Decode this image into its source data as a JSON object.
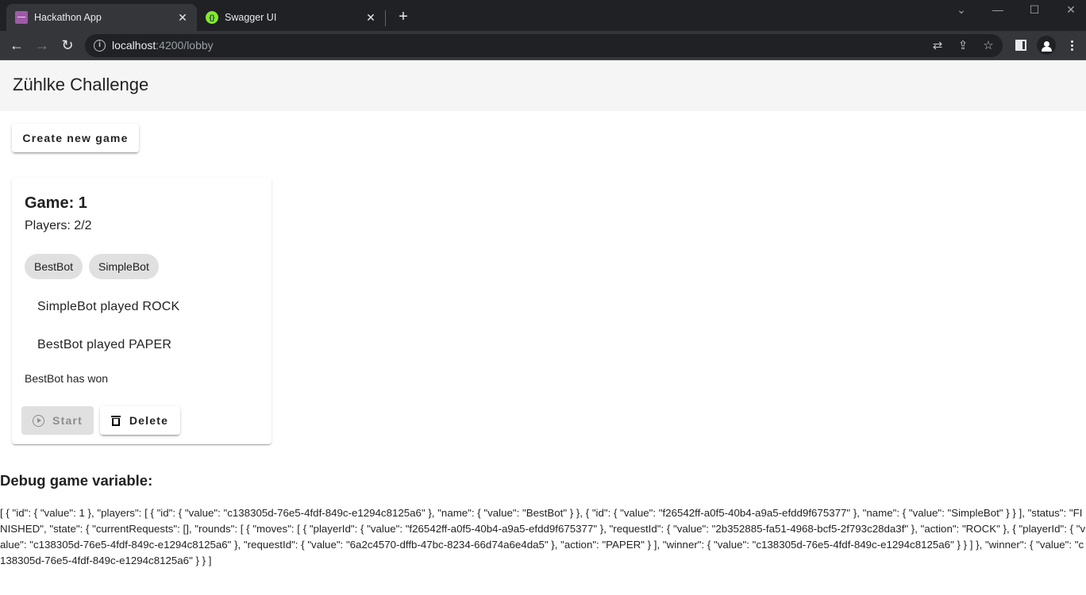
{
  "browser": {
    "tabs": [
      {
        "title": "Hackathon App",
        "favicon": "zuhlke-logo-icon",
        "active": true
      },
      {
        "title": "Swagger UI",
        "favicon": "swagger-icon",
        "active": false
      }
    ],
    "new_tab": "+",
    "close_glyph": "✕",
    "url_host": "localhost",
    "url_path": ":4200/lobby",
    "window_controls": {
      "dropdown": "⌄",
      "minimize": "—",
      "maximize": "☐",
      "close": "✕"
    },
    "nav": {
      "back": "←",
      "forward": "→",
      "reload": "↻"
    },
    "omnibox_icons": {
      "translate": "⇄",
      "share": "⇪",
      "bookmark": "☆"
    }
  },
  "app": {
    "title": "Zühlke Challenge",
    "create_button": "Create new game",
    "game": {
      "title": "Game: 1",
      "players": "Players: 2/2",
      "player_chips": [
        "BestBot",
        "SimpleBot"
      ],
      "moves": [
        "SimpleBot played ROCK",
        "BestBot played PAPER"
      ],
      "result": "BestBot has won",
      "start_button": "Start",
      "delete_button": "Delete"
    },
    "debug": {
      "title": "Debug game variable:",
      "text": "[ { \"id\": { \"value\": 1 }, \"players\": [ { \"id\": { \"value\": \"c138305d-76e5-4fdf-849c-e1294c8125a6\" }, \"name\": { \"value\": \"BestBot\" } }, { \"id\": { \"value\": \"f26542ff-a0f5-40b4-a9a5-efdd9f675377\" }, \"name\": { \"value\": \"SimpleBot\" } } ], \"status\": \"FINISHED\", \"state\": { \"currentRequests\": [], \"rounds\": [ { \"moves\": [ { \"playerId\": { \"value\": \"f26542ff-a0f5-40b4-a9a5-efdd9f675377\" }, \"requestId\": { \"value\": \"2b352885-fa51-4968-bcf5-2f793c28da3f\" }, \"action\": \"ROCK\" }, { \"playerId\": { \"value\": \"c138305d-76e5-4fdf-849c-e1294c8125a6\" }, \"requestId\": { \"value\": \"6a2c4570-dffb-47bc-8234-66d74a6e4da5\" }, \"action\": \"PAPER\" } ], \"winner\": { \"value\": \"c138305d-76e5-4fdf-849c-e1294c8125a6\" } } ] }, \"winner\": { \"value\": \"c138305d-76e5-4fdf-849c-e1294c8125a6\" } } ]"
    }
  }
}
